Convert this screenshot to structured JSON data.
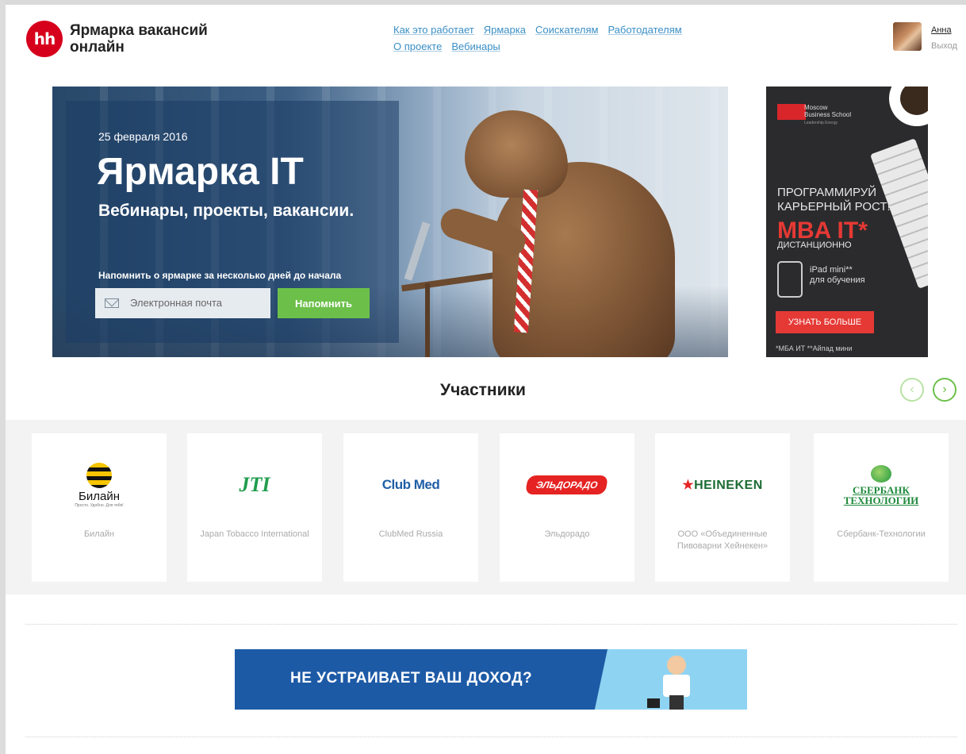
{
  "header": {
    "logo_badge": "hh",
    "logo_line1": "Ярмарка вакансий",
    "logo_line2": "онлайн",
    "nav": [
      "Как это работает",
      "Ярмарка",
      "Соискателям",
      "Работодателям",
      "О проекте",
      "Вебинары"
    ],
    "user_name": "Анна",
    "logout": "Выход"
  },
  "hero": {
    "date": "25 февраля 2016",
    "title": "Ярмарка IT",
    "subtitle": "Вебинары, проекты, вакансии.",
    "remind_text": "Напомнить о ярмарке за несколько дней до начала",
    "email_placeholder": "Электронная почта",
    "remind_button": "Напомнить"
  },
  "ad": {
    "school_line1": "Moscow",
    "school_line2": "Business School",
    "school_tagline": "Leadership Energy",
    "headline": "ПРОГРАММИРУЙ КАРЬЕРНЫЙ РОСТ!",
    "mba": "MBA IT*",
    "mode": "ДИСТАНЦИОННО",
    "ipad": "iPad mini**",
    "ipad_sub": "для обучения",
    "button": "УЗНАТЬ БОЛЬШЕ",
    "footnote": "*МБА ИТ  **Айпад мини",
    "accent_color": "#e53935"
  },
  "participants": {
    "title": "Участники",
    "prev": "‹",
    "next": "›",
    "items": [
      {
        "logo": "Билайн",
        "logo_small": "Просто. Удобно. Для тебя!",
        "name": "Билайн"
      },
      {
        "logo": "JTI",
        "name": "Japan Tobacco International"
      },
      {
        "logo": "Club Med",
        "name": "ClubMed Russia"
      },
      {
        "logo": "ЭЛЬДОРАДО",
        "name": "Эльдорадо"
      },
      {
        "logo": "HEINEKEN",
        "name": "ООО «Объединенные Пивоварни Хейнекен»"
      },
      {
        "logo_line1": "СБЕРБАНК",
        "logo_line2": "ТЕХНОЛОГИИ",
        "name": "Сбербанк-Технологии"
      }
    ]
  },
  "banner": {
    "text": "НЕ УСТРАИВАЕТ ВАШ ДОХОД?"
  },
  "colors": {
    "brand_red": "#d6001c",
    "link": "#3b8fc6",
    "green": "#6cc04a",
    "banner_blue": "#1d5aa6"
  }
}
